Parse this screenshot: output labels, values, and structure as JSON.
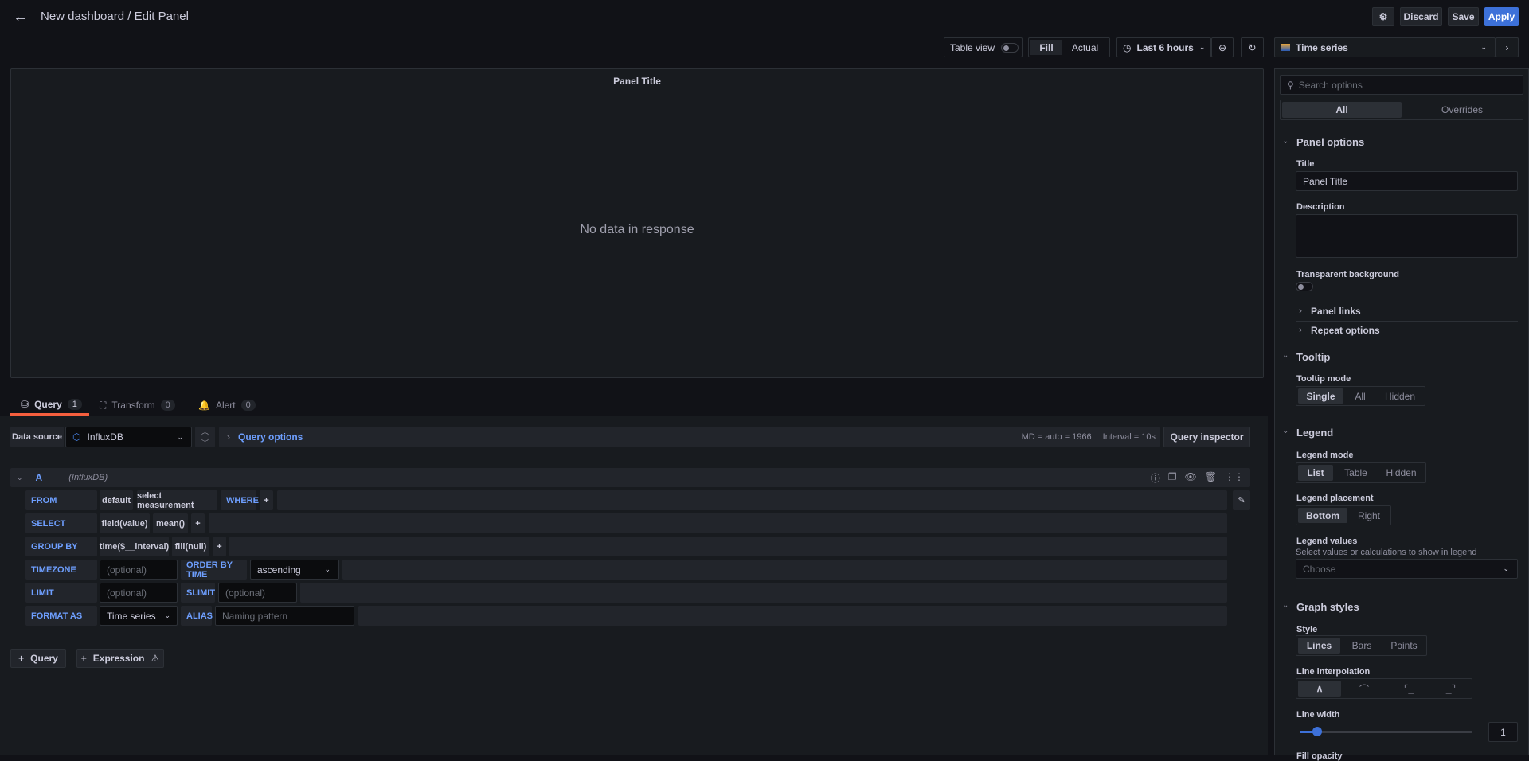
{
  "header": {
    "title": "New dashboard / Edit Panel",
    "discard": "Discard",
    "save": "Save",
    "apply": "Apply"
  },
  "toolbar": {
    "table_view": "Table view",
    "fill": "Fill",
    "actual": "Actual",
    "time_range": "Last 6 hours",
    "visualization": "Time series"
  },
  "panel": {
    "title": "Panel Title",
    "empty": "No data in response"
  },
  "tabs": [
    {
      "label": "Query",
      "count": "1"
    },
    {
      "label": "Transform",
      "count": "0"
    },
    {
      "label": "Alert",
      "count": "0"
    }
  ],
  "datasource": {
    "label": "Data source",
    "value": "InfluxDB",
    "query_options": "Query options",
    "md": "MD = auto = 1966",
    "interval": "Interval = 10s",
    "inspector": "Query inspector"
  },
  "query": {
    "ref": "A",
    "source": "(InfluxDB)",
    "from": {
      "label": "FROM",
      "policy": "default",
      "measurement": "select measurement",
      "where": "WHERE",
      "plus": "+"
    },
    "select": {
      "label": "SELECT",
      "field": "field(value)",
      "agg": "mean()",
      "plus": "+"
    },
    "groupby": {
      "label": "GROUP BY",
      "time": "time($__interval)",
      "fill": "fill(null)",
      "plus": "+"
    },
    "timezone": {
      "label": "TIMEZONE",
      "placeholder": "(optional)",
      "order_label": "ORDER BY TIME",
      "order": "ascending"
    },
    "limit": {
      "label": "LIMIT",
      "placeholder": "(optional)",
      "slimit_label": "SLIMIT",
      "slimit_placeholder": "(optional)"
    },
    "format": {
      "label": "FORMAT AS",
      "value": "Time series",
      "alias_label": "ALIAS",
      "alias_placeholder": "Naming pattern"
    }
  },
  "add": {
    "query": "Query",
    "expression": "Expression"
  },
  "options": {
    "search_placeholder": "Search options",
    "tab_all": "All",
    "tab_overrides": "Overrides",
    "panel_options": "Panel options",
    "title_label": "Title",
    "title_value": "Panel Title",
    "description_label": "Description",
    "transparent_label": "Transparent background",
    "panel_links": "Panel links",
    "repeat_options": "Repeat options",
    "tooltip": "Tooltip",
    "tooltip_mode": "Tooltip mode",
    "tooltip_opts": [
      "Single",
      "All",
      "Hidden"
    ],
    "legend": "Legend",
    "legend_mode": "Legend mode",
    "legend_mode_opts": [
      "List",
      "Table",
      "Hidden"
    ],
    "legend_placement": "Legend placement",
    "legend_placement_opts": [
      "Bottom",
      "Right"
    ],
    "legend_values": "Legend values",
    "legend_values_desc": "Select values or calculations to show in legend",
    "legend_values_placeholder": "Choose",
    "graph_styles": "Graph styles",
    "style": "Style",
    "style_opts": [
      "Lines",
      "Bars",
      "Points"
    ],
    "line_interpolation": "Line interpolation",
    "line_width": "Line width",
    "line_width_value": "1",
    "line_width_fraction": 0.1,
    "fill_opacity": "Fill opacity"
  }
}
